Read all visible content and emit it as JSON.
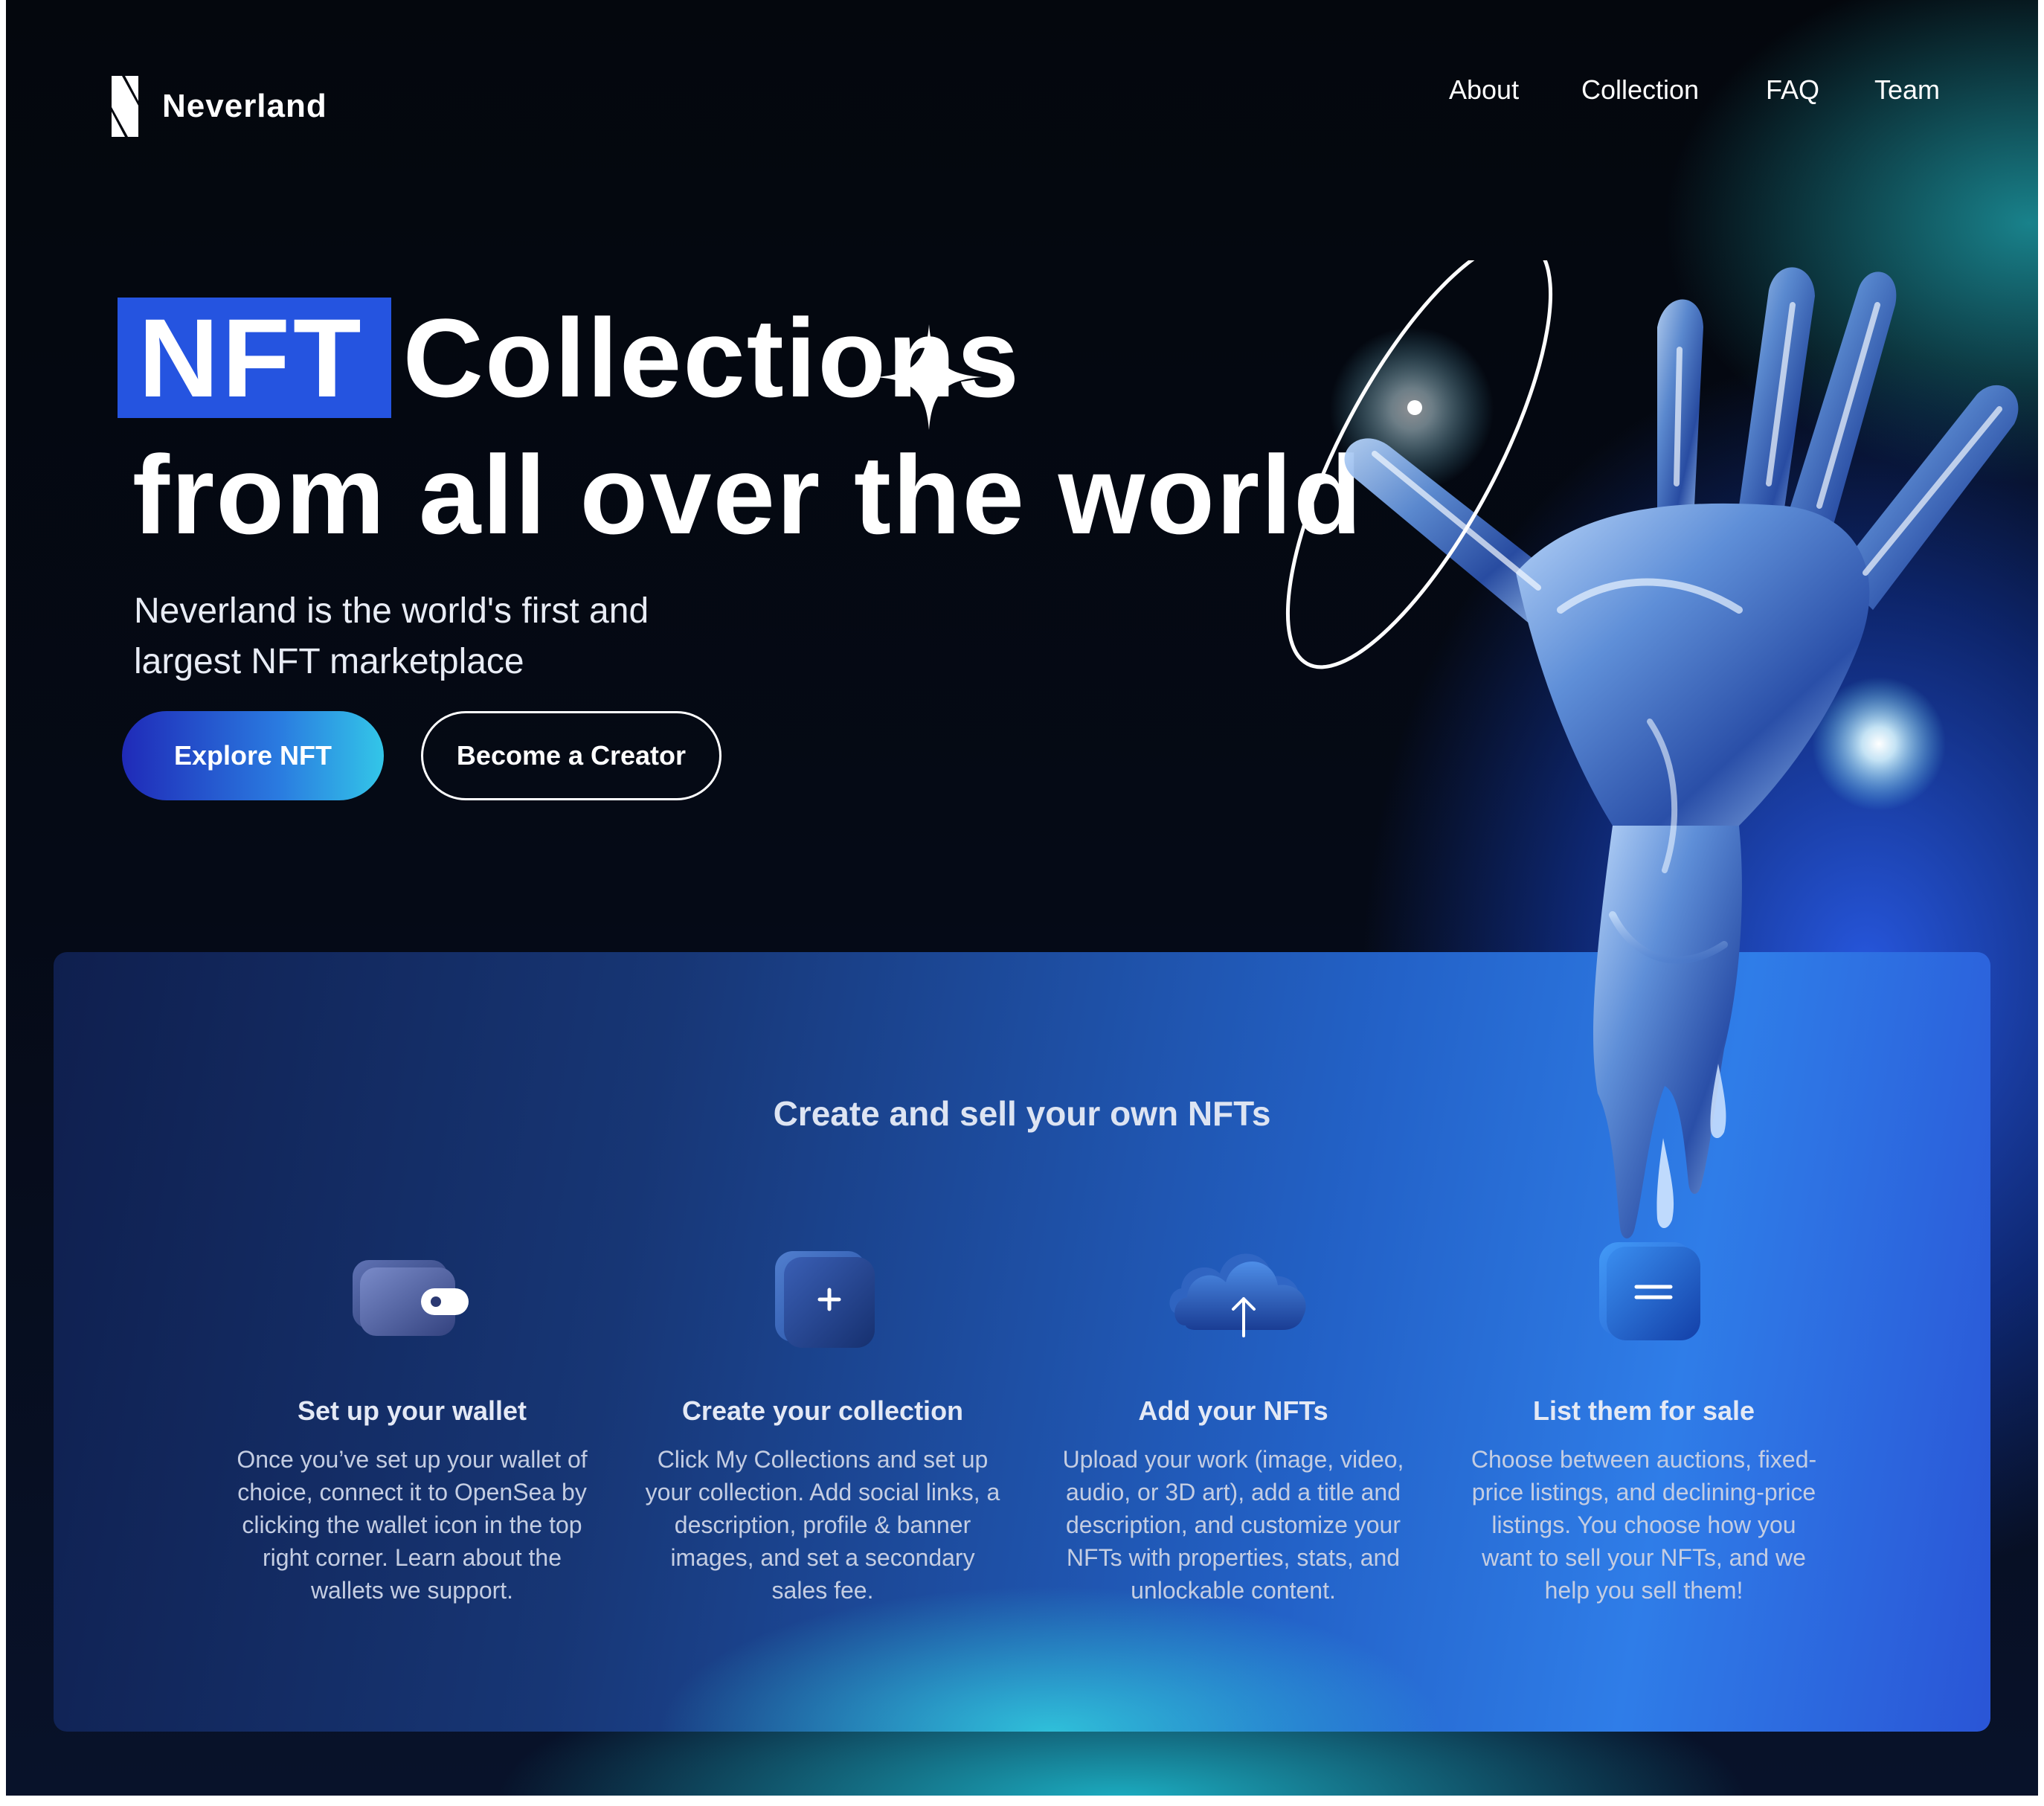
{
  "brand": {
    "name": "Neverland"
  },
  "nav": {
    "items": [
      {
        "label": "About"
      },
      {
        "label": "Collection"
      },
      {
        "label": "FAQ"
      },
      {
        "label": "Team"
      }
    ]
  },
  "hero": {
    "highlight": "NFT",
    "title_rest": "Collections",
    "title_line2": "from all over the world",
    "subtitle": "Neverland is the world's first and largest NFT marketplace",
    "primary_button": "Explore NFT",
    "secondary_button": "Become a Creator"
  },
  "section": {
    "title": "Create and sell your own NFTs",
    "steps": [
      {
        "icon": "wallet-icon",
        "title": "Set up your wallet",
        "description": "Once you’ve set up your wallet of choice, connect it to OpenSea by clicking the wallet icon in the top right corner. Learn about the wallets we support."
      },
      {
        "icon": "add-collection-icon",
        "title": "Create your collection",
        "description": "Click My Collections and set up your collection. Add social links, a description, profile & banner images, and set a secondary sales fee."
      },
      {
        "icon": "cloud-upload-icon",
        "title": "Add your NFTs",
        "description": "Upload your work (image, video, audio, or 3D art), add a title and description, and customize your NFTs with properties, stats, and unlockable content."
      },
      {
        "icon": "list-icon",
        "title": "List them for sale",
        "description": "Choose between auctions, fixed-price listings, and declining-price listings. You choose how you want to sell your NFTs, and we help you sell them!"
      }
    ]
  },
  "colors": {
    "accent": "#2554e0",
    "background": "#05080f",
    "text": "#ffffff"
  }
}
